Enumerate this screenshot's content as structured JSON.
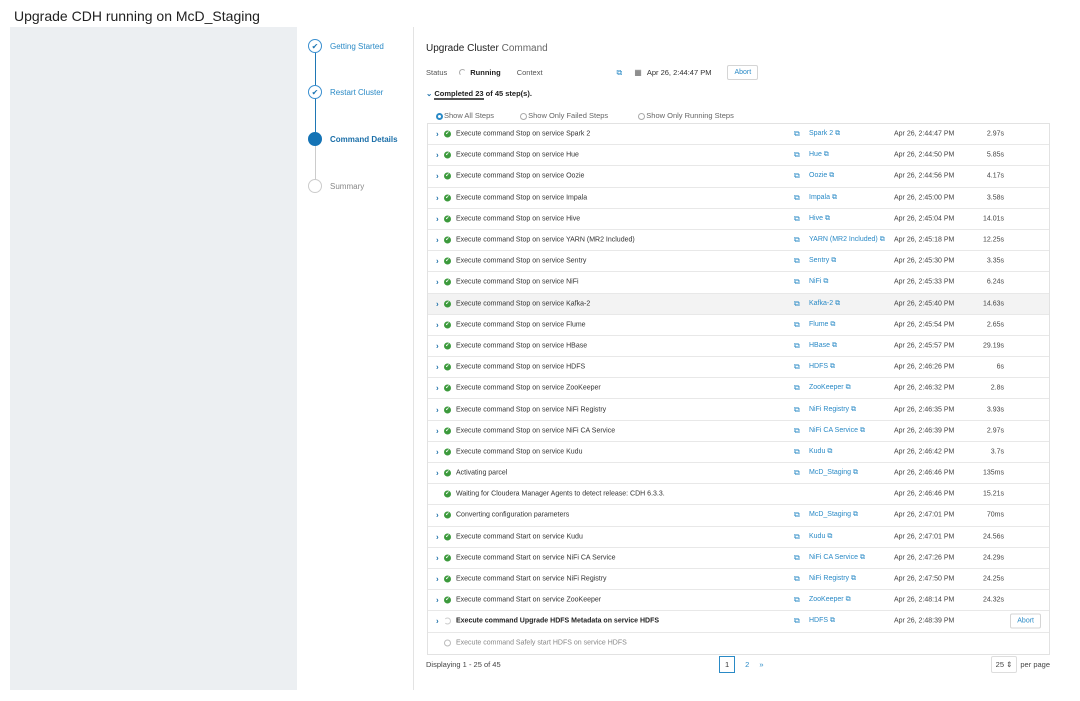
{
  "page_title": "Upgrade CDH running on McD_Staging",
  "wizard": [
    {
      "label": "Getting Started",
      "state": "done"
    },
    {
      "label": "Restart Cluster",
      "state": "done"
    },
    {
      "label": "Command Details",
      "state": "active"
    },
    {
      "label": "Summary",
      "state": "future"
    }
  ],
  "header": {
    "title": "Upgrade Cluster",
    "title_suffix": "Command",
    "status_label": "Status",
    "status_value": "Running",
    "context_label": "Context",
    "date": "Apr 26, 2:44:47 PM",
    "abort": "Abort"
  },
  "progress": {
    "text_prefix": "Completed 23",
    "text_suffix": " of 45 step(s).",
    "completed": 23,
    "total": 45
  },
  "filters": {
    "all": "Show All Steps",
    "failed": "Show Only Failed Steps",
    "running": "Show Only Running Steps",
    "selected": "all"
  },
  "steps": [
    {
      "desc": "Execute command Stop on service Spark 2",
      "svc": "Spark 2",
      "date": "Apr 26, 2:44:47 PM",
      "dur": "2.97s",
      "state": "done"
    },
    {
      "desc": "Execute command Stop on service Hue",
      "svc": "Hue",
      "date": "Apr 26, 2:44:50 PM",
      "dur": "5.85s",
      "state": "done"
    },
    {
      "desc": "Execute command Stop on service Oozie",
      "svc": "Oozie",
      "date": "Apr 26, 2:44:56 PM",
      "dur": "4.17s",
      "state": "done"
    },
    {
      "desc": "Execute command Stop on service Impala",
      "svc": "Impala",
      "date": "Apr 26, 2:45:00 PM",
      "dur": "3.58s",
      "state": "done"
    },
    {
      "desc": "Execute command Stop on service Hive",
      "svc": "Hive",
      "date": "Apr 26, 2:45:04 PM",
      "dur": "14.01s",
      "state": "done"
    },
    {
      "desc": "Execute command Stop on service YARN (MR2 Included)",
      "svc": "YARN (MR2 Included)",
      "date": "Apr 26, 2:45:18 PM",
      "dur": "12.25s",
      "state": "done"
    },
    {
      "desc": "Execute command Stop on service Sentry",
      "svc": "Sentry",
      "date": "Apr 26, 2:45:30 PM",
      "dur": "3.35s",
      "state": "done"
    },
    {
      "desc": "Execute command Stop on service NiFi",
      "svc": "NiFi",
      "date": "Apr 26, 2:45:33 PM",
      "dur": "6.24s",
      "state": "done"
    },
    {
      "desc": "Execute command Stop on service Kafka-2",
      "svc": "Kafka-2",
      "date": "Apr 26, 2:45:40 PM",
      "dur": "14.63s",
      "state": "done",
      "hover": true
    },
    {
      "desc": "Execute command Stop on service Flume",
      "svc": "Flume",
      "date": "Apr 26, 2:45:54 PM",
      "dur": "2.65s",
      "state": "done"
    },
    {
      "desc": "Execute command Stop on service HBase",
      "svc": "HBase",
      "date": "Apr 26, 2:45:57 PM",
      "dur": "29.19s",
      "state": "done"
    },
    {
      "desc": "Execute command Stop on service HDFS",
      "svc": "HDFS",
      "date": "Apr 26, 2:46:26 PM",
      "dur": "6s",
      "state": "done"
    },
    {
      "desc": "Execute command Stop on service ZooKeeper",
      "svc": "ZooKeeper",
      "date": "Apr 26, 2:46:32 PM",
      "dur": "2.8s",
      "state": "done"
    },
    {
      "desc": "Execute command Stop on service NiFi Registry",
      "svc": "NiFi Registry",
      "date": "Apr 26, 2:46:35 PM",
      "dur": "3.93s",
      "state": "done"
    },
    {
      "desc": "Execute command Stop on service NiFi CA Service",
      "svc": "NiFi CA Service",
      "date": "Apr 26, 2:46:39 PM",
      "dur": "2.97s",
      "state": "done"
    },
    {
      "desc": "Execute command Stop on service Kudu",
      "svc": "Kudu",
      "date": "Apr 26, 2:46:42 PM",
      "dur": "3.7s",
      "state": "done"
    },
    {
      "desc": "Activating parcel",
      "svc": "McD_Staging",
      "date": "Apr 26, 2:46:46 PM",
      "dur": "135ms",
      "state": "done"
    },
    {
      "desc": "Waiting for Cloudera Manager Agents to detect release: CDH 6.3.3.",
      "svc": "",
      "date": "Apr 26, 2:46:46 PM",
      "dur": "15.21s",
      "state": "done",
      "nochev": true
    },
    {
      "desc": "Converting configuration parameters",
      "svc": "McD_Staging",
      "date": "Apr 26, 2:47:01 PM",
      "dur": "70ms",
      "state": "done"
    },
    {
      "desc": "Execute command Start on service Kudu",
      "svc": "Kudu",
      "date": "Apr 26, 2:47:01 PM",
      "dur": "24.56s",
      "state": "done"
    },
    {
      "desc": "Execute command Start on service NiFi CA Service",
      "svc": "NiFi CA Service",
      "date": "Apr 26, 2:47:26 PM",
      "dur": "24.29s",
      "state": "done"
    },
    {
      "desc": "Execute command Start on service NiFi Registry",
      "svc": "NiFi Registry",
      "date": "Apr 26, 2:47:50 PM",
      "dur": "24.25s",
      "state": "done"
    },
    {
      "desc": "Execute command Start on service ZooKeeper",
      "svc": "ZooKeeper",
      "date": "Apr 26, 2:48:14 PM",
      "dur": "24.32s",
      "state": "done"
    },
    {
      "desc": "Execute command Upgrade HDFS Metadata on service HDFS",
      "svc": "HDFS",
      "date": "Apr 26, 2:48:39 PM",
      "dur": "",
      "state": "running",
      "abort": "Abort"
    },
    {
      "desc": "Execute command Safely start HDFS on service HDFS",
      "svc": "",
      "date": "",
      "dur": "",
      "state": "pending",
      "nochev": true
    }
  ],
  "footer": {
    "displaying": "Displaying 1 - 25 of 45",
    "pages": [
      "1",
      "2"
    ],
    "current_page": "1",
    "next": "»",
    "per_page_value": "25",
    "per_page_label": "per page"
  }
}
